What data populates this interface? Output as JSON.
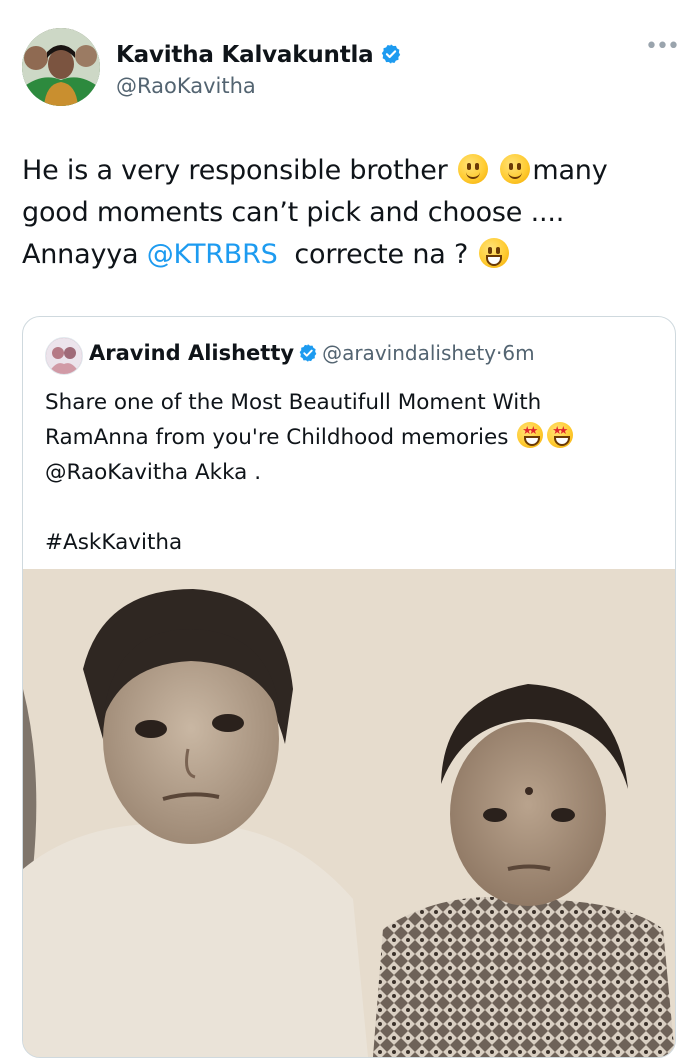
{
  "author": {
    "name": "Kavitha Kalvakuntla",
    "handle": "@RaoKavitha",
    "verified_icon": "verified-badge-icon",
    "more_icon": "more-icon",
    "more_glyph": "•••"
  },
  "tweet": {
    "line1_a": "He is a very responsible brother",
    "line1_b": "many",
    "line2": "good moments can’t pick and choose ....",
    "line3_a": "Annayya",
    "line3_mention": "@KTRBRS",
    "line3_b": "correcte na ?"
  },
  "quoted": {
    "name": "Aravind Alishetty",
    "handle": "@aravindalishety",
    "time": "6m",
    "separator": "·",
    "line1": "Share one of the Most Beautifull Moment With",
    "line2": "RamAnna from you're Childhood memories",
    "line3": "@RaoKavitha Akka .",
    "hashtag": "#AskKavitha"
  },
  "colors": {
    "link": "#1d9bf0",
    "secondary_text": "#536471",
    "border": "#cfd9de",
    "verified": "#1d9bf0"
  }
}
